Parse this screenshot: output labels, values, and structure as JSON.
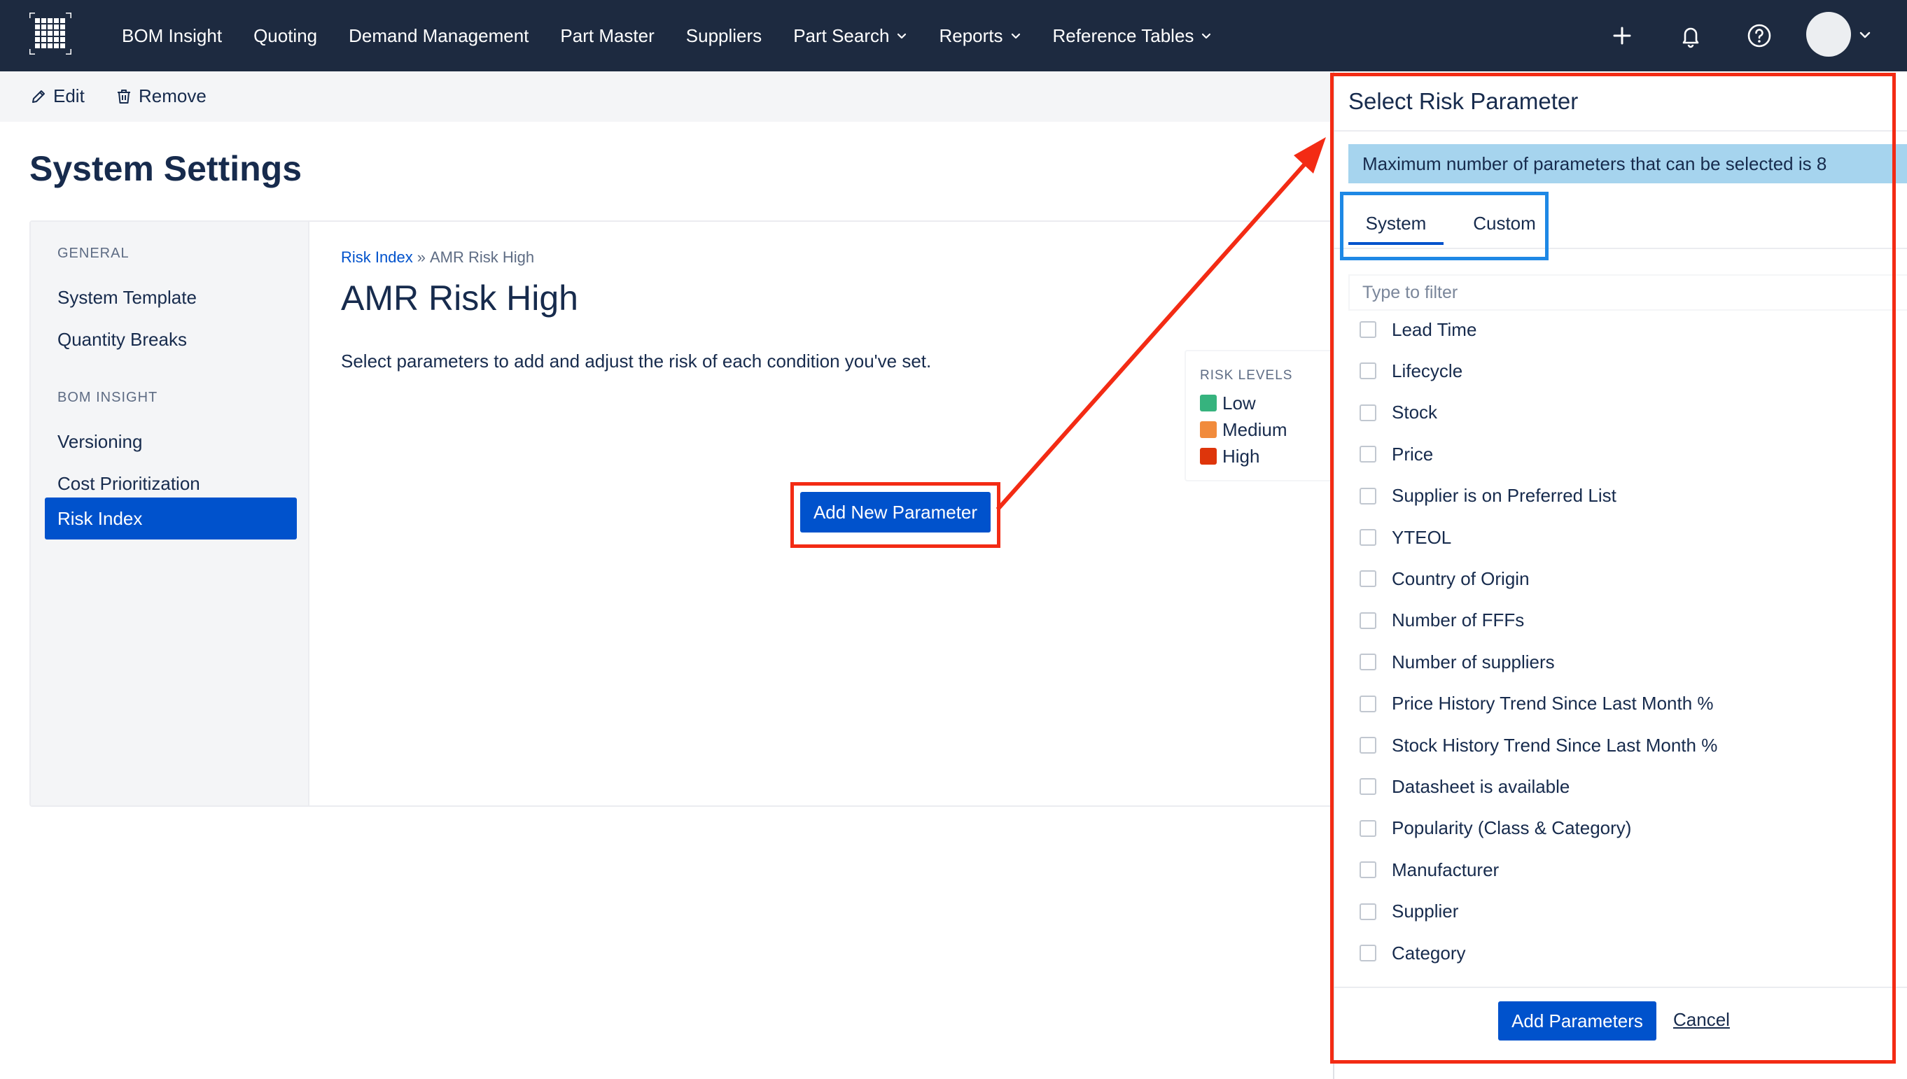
{
  "nav": {
    "items": [
      {
        "label": "BOM Insight",
        "dropdown": false
      },
      {
        "label": "Quoting",
        "dropdown": false
      },
      {
        "label": "Demand Management",
        "dropdown": false
      },
      {
        "label": "Part Master",
        "dropdown": false
      },
      {
        "label": "Suppliers",
        "dropdown": false
      },
      {
        "label": "Part Search",
        "dropdown": true
      },
      {
        "label": "Reports",
        "dropdown": true
      },
      {
        "label": "Reference Tables",
        "dropdown": true
      }
    ],
    "icons": [
      "plus-icon",
      "bell-icon",
      "help-icon"
    ],
    "logo_icon": "grid-logo-icon"
  },
  "toolbar": {
    "edit_label": "Edit",
    "remove_label": "Remove"
  },
  "page": {
    "title": "System Settings"
  },
  "sidebar": {
    "sections": [
      {
        "heading": "GENERAL",
        "items": [
          "System Template",
          "Quantity Breaks"
        ]
      },
      {
        "heading": "BOM INSIGHT",
        "items": [
          "Versioning",
          "Cost Prioritization",
          "Risk Index"
        ]
      }
    ],
    "active_item": "Risk Index"
  },
  "content": {
    "breadcrumb_link": "Risk Index",
    "breadcrumb_sep": "»",
    "breadcrumb_current": "AMR Risk High",
    "title": "AMR Risk High",
    "description": "Select parameters to add and adjust the risk of each condition you've set.",
    "add_button_label": "Add New Parameter"
  },
  "risk_levels": {
    "heading": "RISK LEVELS",
    "levels": [
      {
        "label": "Low",
        "color": "#36b37e"
      },
      {
        "label": "Medium",
        "color": "#f18b3c"
      },
      {
        "label": "High",
        "color": "#de350b"
      }
    ]
  },
  "drawer": {
    "title": "Select Risk Parameter",
    "info": "Maximum number of parameters that can be selected is 8",
    "tabs": [
      {
        "label": "System",
        "active": true
      },
      {
        "label": "Custom",
        "active": false
      }
    ],
    "filter_placeholder": "Type to filter",
    "parameters": [
      {
        "label": "Lead Time",
        "checked": false
      },
      {
        "label": "Lifecycle",
        "checked": false
      },
      {
        "label": "Stock",
        "checked": false
      },
      {
        "label": "Price",
        "checked": false
      },
      {
        "label": "Supplier is on Preferred List",
        "checked": false
      },
      {
        "label": "YTEOL",
        "checked": false
      },
      {
        "label": "Country of Origin",
        "checked": false
      },
      {
        "label": "Number of FFFs",
        "checked": false
      },
      {
        "label": "Number of suppliers",
        "checked": false
      },
      {
        "label": "Price History Trend Since Last Month %",
        "checked": false
      },
      {
        "label": "Stock History Trend Since Last Month %",
        "checked": false
      },
      {
        "label": "Datasheet is available",
        "checked": false
      },
      {
        "label": "Popularity (Class & Category)",
        "checked": false
      },
      {
        "label": "Manufacturer",
        "checked": false
      },
      {
        "label": "Supplier",
        "checked": false
      },
      {
        "label": "Category",
        "checked": false
      }
    ],
    "add_label": "Add Parameters",
    "cancel_label": "Cancel"
  },
  "colors": {
    "nav_bg": "#1d2a40",
    "primary": "#0052cc",
    "info_banner": "#a6d4ee",
    "annotation_red": "#f32b14",
    "annotation_blue": "#1e88e5"
  }
}
